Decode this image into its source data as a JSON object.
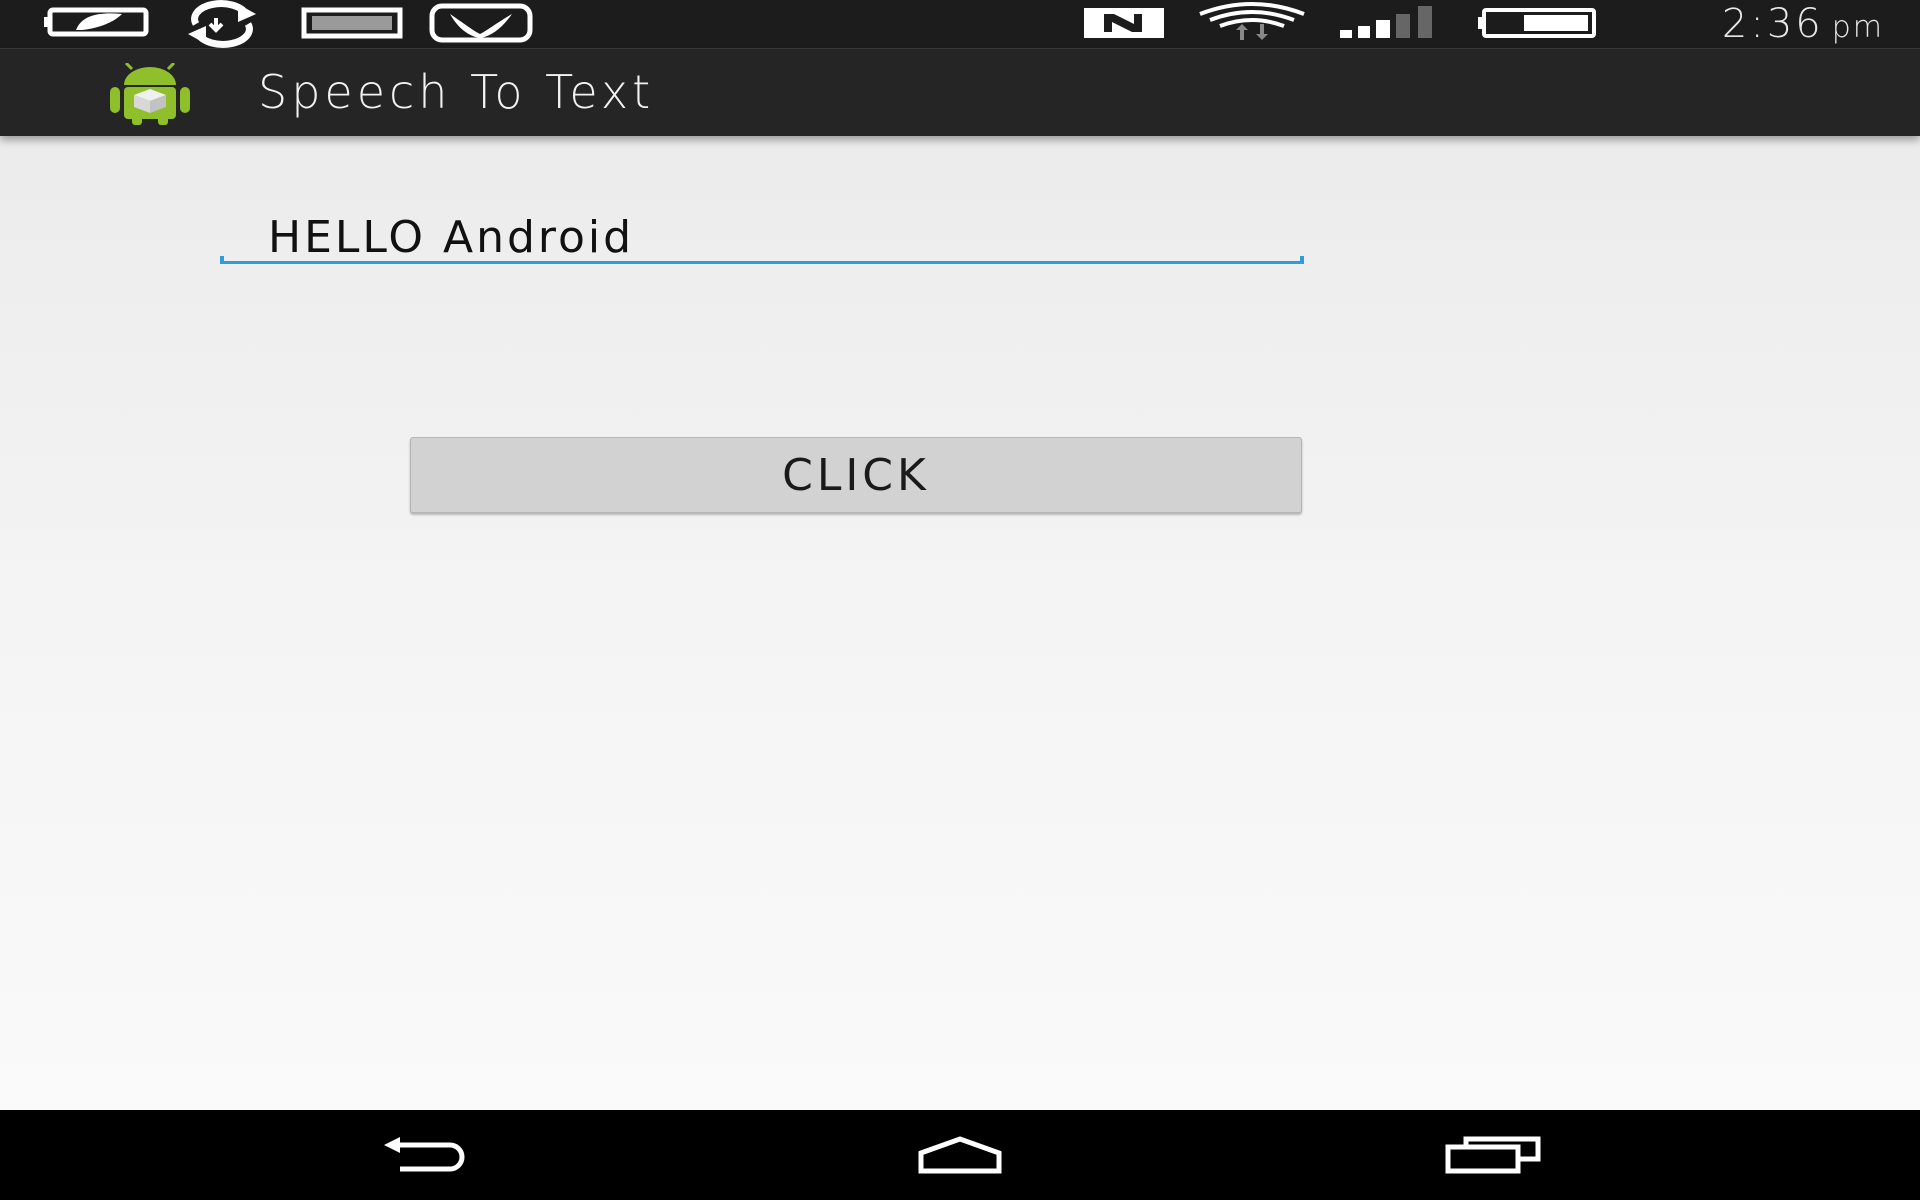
{
  "status_bar": {
    "left_icons": [
      "battery-saver-icon",
      "sync-icon",
      "storage-icon",
      "saavn-icon"
    ],
    "right_icons": [
      "nfc-icon",
      "wifi-icon",
      "signal-icon",
      "battery-icon"
    ],
    "time": "2:36",
    "ampm": "pm"
  },
  "action_bar": {
    "app_icon": "android-app-icon",
    "title": "Speech To Text"
  },
  "main": {
    "text_field_value": "HELLO Android",
    "accent_color": "#2f9ed8",
    "button_label": "CLICK"
  },
  "nav_bar": {
    "buttons": [
      "back-icon",
      "home-icon",
      "recent-apps-icon"
    ]
  }
}
